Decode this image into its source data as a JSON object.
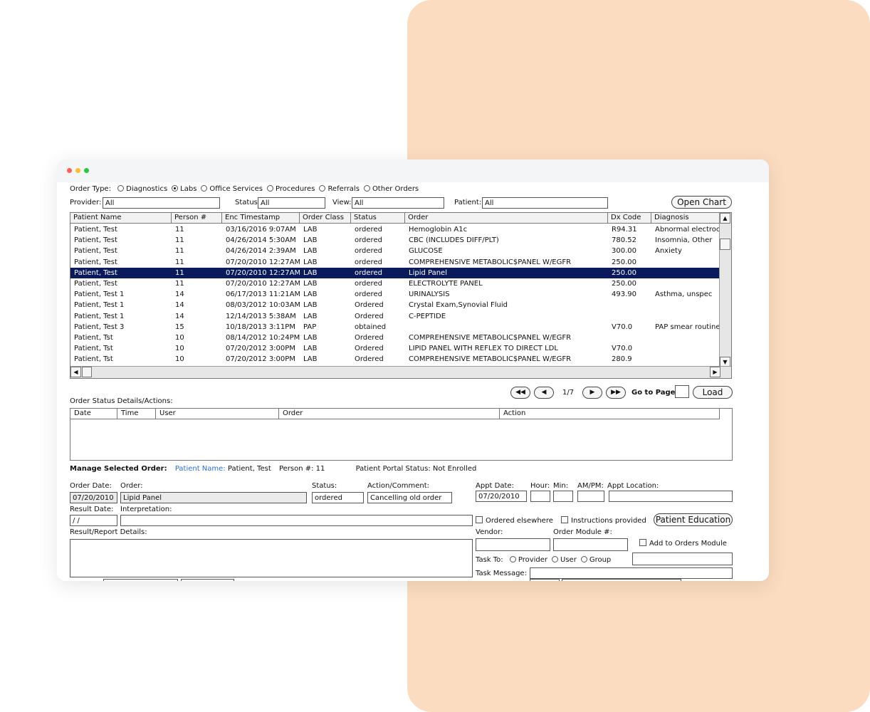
{
  "window": {
    "dots": [
      "#ff5f57",
      "#febc2e",
      "#28c840"
    ]
  },
  "order_type": {
    "label": "Order Type:",
    "options": [
      "Diagnostics",
      "Labs",
      "Office Services",
      "Procedures",
      "Referrals",
      "Other Orders"
    ],
    "selected": "Labs"
  },
  "filters": {
    "provider_label": "Provider:",
    "provider_value": "All",
    "status_label": "Status:",
    "status_value": "All",
    "view_label": "View:",
    "view_value": "All",
    "patient_label": "Patient:",
    "patient_value": "All",
    "open_chart": "Open Chart"
  },
  "orders_table": {
    "columns": [
      "Patient Name",
      "Person #",
      "Enc Timestamp",
      "Order Class",
      "Status",
      "Order",
      "Dx Code",
      "Diagnosis"
    ],
    "selected_index": 4,
    "rows": [
      [
        "Patient, Test",
        "11",
        "03/16/2016  9:07AM",
        "LAB",
        "ordered",
        "Hemoglobin A1c",
        "R94.31",
        "Abnormal electroc"
      ],
      [
        "Patient, Test",
        "11",
        "04/26/2014  5:30AM",
        "LAB",
        "ordered",
        "CBC (INCLUDES DIFF/PLT)",
        "780.52",
        "Insomnia, Other"
      ],
      [
        "Patient, Test",
        "11",
        "04/26/2014  2:39AM",
        "LAB",
        "ordered",
        "GLUCOSE",
        "300.00",
        "Anxiety"
      ],
      [
        "Patient, Test",
        "11",
        "07/20/2010 12:27AM",
        "LAB",
        "ordered",
        "COMPREHENSIVE METABOLIC$PANEL W/EGFR",
        "250.00",
        ""
      ],
      [
        "Patient, Test",
        "11",
        "07/20/2010 12:27AM",
        "LAB",
        "ordered",
        "Lipid Panel",
        "250.00",
        ""
      ],
      [
        "Patient, Test",
        "11",
        "07/20/2010 12:27AM",
        "LAB",
        "ordered",
        "ELECTROLYTE PANEL",
        "250.00",
        ""
      ],
      [
        "Patient, Test 1",
        "14",
        "06/17/2013 11:21AM",
        "LAB",
        "ordered",
        "URINALYSIS",
        "493.90",
        "Asthma, unspec"
      ],
      [
        "Patient, Test 1",
        "14",
        "08/03/2012 10:03AM",
        "LAB",
        "Ordered",
        "Crystal Exam,Synovial Fluid",
        "",
        ""
      ],
      [
        "Patient, Test 1",
        "14",
        "12/14/2013  5:38AM",
        "LAB",
        "Ordered",
        "C-PEPTIDE",
        "",
        ""
      ],
      [
        "Patient, Test 3",
        "15",
        "10/18/2013  3:11PM",
        "PAP",
        "obtained",
        "",
        "V70.0",
        "PAP smear routine"
      ],
      [
        "Patient, Tst",
        "10",
        "08/14/2012 10:24PM",
        "LAB",
        "Ordered",
        "COMPREHENSIVE METABOLIC$PANEL W/EGFR",
        "",
        ""
      ],
      [
        "Patient, Tst",
        "10",
        "07/20/2012  3:00PM",
        "LAB",
        "Ordered",
        "LIPID PANEL WITH REFLEX TO DIRECT LDL",
        "V70.0",
        ""
      ],
      [
        "Patient, Tst",
        "10",
        "07/20/2012  3:00PM",
        "LAB",
        "Ordered",
        "COMPREHENSIVE METABOLIC$PANEL W/EGFR",
        "280.9",
        ""
      ]
    ]
  },
  "pagination": {
    "page": "1/7",
    "goto_label": "Go to Page:",
    "goto_value": "",
    "load": "Load"
  },
  "status_details": {
    "label": "Order Status Details/Actions:",
    "columns": [
      "Date",
      "Time",
      "User",
      "Order",
      "Action"
    ]
  },
  "manage": {
    "label": "Manage Selected Order:",
    "patient_name_label": "Patient Name:",
    "patient_name": "Patient, Test",
    "person_label": "Person #:",
    "person": "11",
    "portal_label": "Patient Portal Status:",
    "portal": "Not Enrolled",
    "order_date_label": "Order Date:",
    "order_date": "07/20/2010",
    "order_label": "Order:",
    "order": "Lipid Panel",
    "status_label": "Status:",
    "status": "ordered",
    "action_label": "Action/Comment:",
    "action": "Cancelling old order",
    "appt_date_label": "Appt Date:",
    "appt_date": "07/20/2010",
    "hour_label": "Hour:",
    "min_label": "Min:",
    "ampm_label": "AM/PM:",
    "appt_location_label": "Appt Location:",
    "result_date_label": "Result Date:",
    "result_date": " / /",
    "interpretation_label": "Interpretation:",
    "ordered_elsewhere": "Ordered elsewhere",
    "instructions_provided": "Instructions provided",
    "patient_education": "Patient Education",
    "result_details_label": "Result/Report Details:",
    "vendor_label": "Vendor:",
    "order_module_label": "Order Module #:",
    "add_to_orders_module": "Add to Orders Module",
    "task_to_label": "Task To:",
    "task_options": [
      "Provider",
      "User",
      "Group"
    ],
    "task_message_label": "Task Message:"
  }
}
